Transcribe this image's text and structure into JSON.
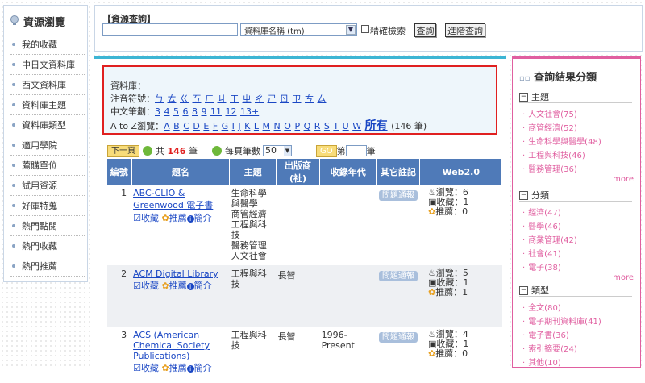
{
  "sidebar": {
    "title": "資源瀏覽",
    "items": [
      "我的收藏",
      "中日文資料庫",
      "西文資料庫",
      "資料庫主題",
      "資料庫類型",
      "適用學院",
      "薦購單位",
      "試用資源",
      "好庫特蒐",
      "熱門點閱",
      "熱門收藏",
      "熱門推薦"
    ]
  },
  "search": {
    "title": "【資源查詢】",
    "input_value": "",
    "field_select": "資料庫名稱 (tm)",
    "precise_label": "精確檢索",
    "search_btn": "查詢",
    "advanced_btn": "進階查詢"
  },
  "db": {
    "label": "資料庫：",
    "zhuyin_label": "注音符號：",
    "zhuyin": [
      "ㄅ",
      "ㄊ",
      "ㄍ",
      "ㄎ",
      "ㄏ",
      "ㄐ",
      "ㄒ",
      "ㄓ",
      "ㄔ",
      "ㄕ",
      "ㄖ",
      "ㄗ",
      "ㄘ",
      "ㄙ"
    ],
    "stroke_label": "中文筆劃：",
    "strokes": [
      "3",
      "4",
      "5",
      "6",
      "8",
      "9",
      "11",
      "12",
      "13+"
    ],
    "az_label": "A to Z瀏覽：",
    "letters": [
      "A",
      "B",
      "C",
      "D",
      "E",
      "F",
      "G",
      "I",
      "J",
      "K",
      "L",
      "M",
      "N",
      "O",
      "P",
      "Q",
      "R",
      "S",
      "T",
      "U",
      "W"
    ],
    "all_label": "所有",
    "all_count": "(146 筆)"
  },
  "pager": {
    "next": "下一頁",
    "total_prefix": "共",
    "total": "146",
    "total_suffix": "筆",
    "per_page_label": "每頁筆數",
    "per_page": "50",
    "go": "GO",
    "page_prefix": "第",
    "page_suffix": "筆"
  },
  "table": {
    "headers": [
      "編號",
      "題名",
      "主題",
      "出版商(社)",
      "收錄年代",
      "其它註記",
      "Web2.0"
    ],
    "report_label": "問題通報",
    "collect_label": "收藏",
    "recommend_label": "推薦",
    "intro_label": "簡介",
    "rows": [
      {
        "no": "1",
        "title": "ABC-CLIO & Greenwood 電子書",
        "subjects": [
          "生命科學與醫學",
          "商管經濟",
          "工程與科技",
          "醫務管理",
          "人文社會"
        ],
        "publisher": "",
        "years": "",
        "views": "瀏覽：6",
        "collects": "收藏：1",
        "recs": "推薦：0"
      },
      {
        "no": "2",
        "title": "ACM Digital Library",
        "subjects": [
          "工程與科技"
        ],
        "publisher": "長智",
        "years": "",
        "views": "瀏覽：5",
        "collects": "收藏：1",
        "recs": "推薦：1"
      },
      {
        "no": "3",
        "title": "ACS (American Chemical Society Publications)",
        "subjects": [
          "工程與科技"
        ],
        "publisher": "長智",
        "years": "1996-Present",
        "views": "瀏覽：4",
        "collects": "收藏：1",
        "recs": "推薦：0"
      }
    ]
  },
  "facets": {
    "title": "查詢結果分類",
    "more": "more",
    "groups": [
      {
        "name": "主題",
        "items": [
          "人文社會(75)",
          "商管經濟(52)",
          "生命科學與醫學(48)",
          "工程與科技(46)",
          "醫務管理(36)"
        ]
      },
      {
        "name": "分類",
        "items": [
          "經濟(47)",
          "醫學(46)",
          "商業管理(42)",
          "社會(41)",
          "電子(38)"
        ]
      },
      {
        "name": "類型",
        "items": [
          "全文(80)",
          "電子期刊資料庫(41)",
          "電子書(36)",
          "索引摘要(24)",
          "其他(10)"
        ]
      }
    ]
  }
}
